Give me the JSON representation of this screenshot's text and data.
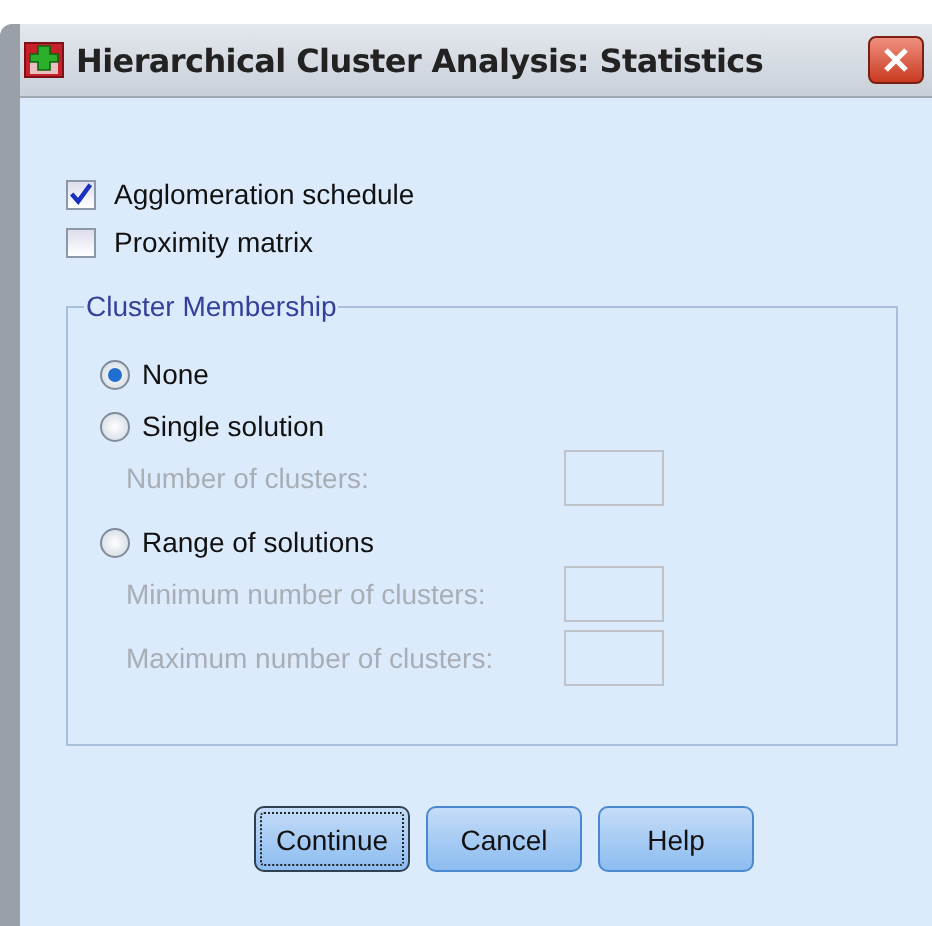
{
  "window": {
    "title": "Hierarchical Cluster Analysis: Statistics"
  },
  "checkboxes": [
    {
      "label": "Agglomeration schedule",
      "checked": true
    },
    {
      "label": "Proximity matrix",
      "checked": false
    }
  ],
  "cluster_membership": {
    "title": "Cluster Membership",
    "options": [
      {
        "kind": "radio",
        "label": "None",
        "selected": true
      },
      {
        "kind": "radio",
        "label": "Single solution",
        "selected": false
      },
      {
        "kind": "field",
        "label": "Number of clusters:",
        "disabled": true
      },
      {
        "kind": "radio",
        "label": "Range of solutions",
        "selected": false
      },
      {
        "kind": "field",
        "label": "Minimum number of clusters:",
        "disabled": true
      },
      {
        "kind": "field",
        "label": "Maximum number of clusters:",
        "disabled": true
      }
    ]
  },
  "buttons": [
    {
      "label": "Continue",
      "focused": true
    },
    {
      "label": "Cancel",
      "focused": false
    },
    {
      "label": "Help",
      "focused": false
    }
  ]
}
